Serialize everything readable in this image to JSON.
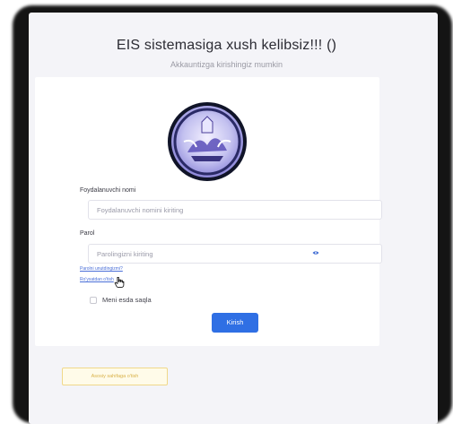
{
  "header": {
    "title": "EIS sistemasiga xush kelibsiz!!! ()",
    "subtitle": "Akkauntizga kirishingiz mumkin"
  },
  "form": {
    "username_label": "Foydalanuvchi nomi",
    "username_placeholder": "Foydalanuvchi nomini kiriting",
    "password_label": "Parol",
    "password_placeholder": "Parolingizni kiriting",
    "forgot_password_link": "Parolni unutdingizmi?",
    "register_link": "Ro'yxatdan o'tish",
    "remember_label": "Meni esda saqla",
    "submit_label": "Kirish"
  },
  "footer": {
    "back_label": "Asosiy sahifaga o'tish"
  },
  "colors": {
    "primary": "#2f6fe4",
    "background": "#f4f4f8",
    "back_button_border": "#f0d88a",
    "link": "#4a6fd8"
  },
  "icons": {
    "password_toggle": "eye-icon",
    "logo": "university-emblem",
    "pointer": "hand-cursor-icon"
  }
}
